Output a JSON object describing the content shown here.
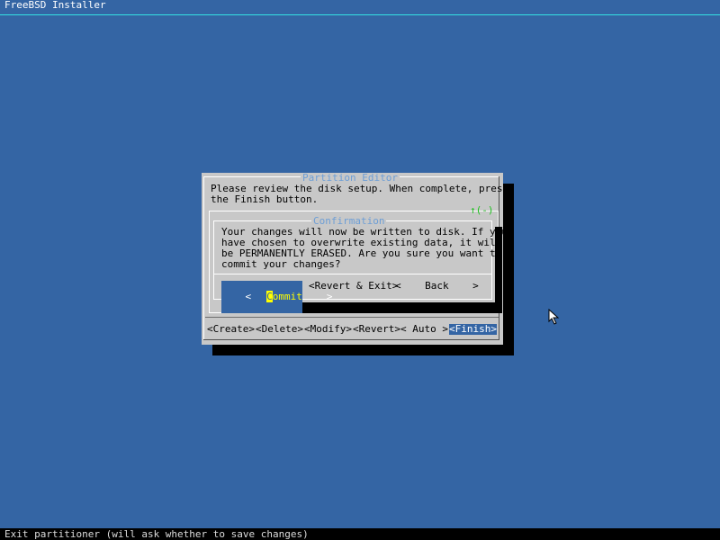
{
  "header": {
    "title": "FreeBSD Installer"
  },
  "partition_editor": {
    "title": "Partition Editor",
    "message_lines": [
      "Please review the disk setup. When complete, press",
      "the Finish button."
    ],
    "scroll_indicator": "↑(-)",
    "buttons": [
      {
        "label": "<Create>"
      },
      {
        "label": "<Delete>"
      },
      {
        "label": "<Modify>"
      },
      {
        "label": "<Revert>"
      },
      {
        "label": "< Auto >"
      },
      {
        "label": "<Finish>"
      }
    ],
    "selected_button": "<Finish>"
  },
  "confirmation": {
    "title": "Confirmation",
    "message_lines": [
      "Your changes will now be written to disk. If you",
      "have chosen to overwrite existing data, it will",
      "be PERMANENTLY ERASED. Are you sure you want to",
      "commit your changes?"
    ],
    "commit": {
      "left": "<",
      "hotkey": "C",
      "rest": "ommit",
      "right": ">"
    },
    "revert_exit_label": "<Revert & Exit>",
    "back_label": "<    Back    >",
    "selected_button": "Commit"
  },
  "status_bar": {
    "text": "Exit partitioner (will ask whether to save changes)"
  },
  "colors": {
    "desktop": "#3465a4",
    "dialog": "#c8c8c8",
    "title_text": "#6d9ed6",
    "selected": "#3465a4",
    "hotkey": "#ffff00",
    "header_line": "#34e2e2"
  },
  "icons": {
    "mouse": "mouse-pointer-icon"
  }
}
